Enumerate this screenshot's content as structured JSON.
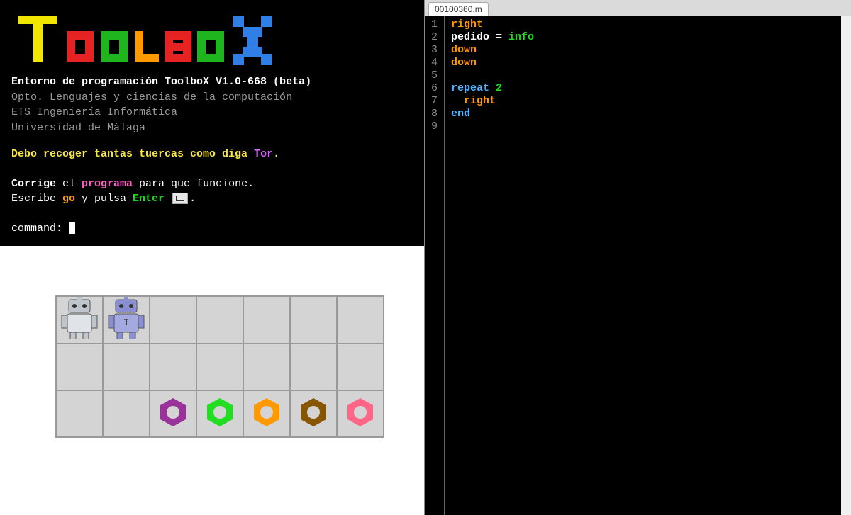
{
  "logo": {
    "letters": [
      "T",
      "O",
      "O",
      "L",
      "B",
      "O",
      "X"
    ]
  },
  "console": {
    "version": "Entorno de programación ToolboX V1.0-668 (beta)",
    "dept": "Opto. Lenguajes y ciencias de la computación",
    "school": "ETS Ingeniería Informática",
    "university": "Universidad de Málaga",
    "task_pre": "Debo recoger tantas tuercas como diga ",
    "task_name": "Tor",
    "task_post": ".",
    "inst_corrige": "Corrige",
    "inst_el": " el ",
    "inst_programa": "programa",
    "inst_rest": " para que funcione.",
    "inst2_pre": "Escribe ",
    "inst2_go": "go",
    "inst2_mid": " y pulsa ",
    "inst2_enter": "Enter",
    "inst2_post": ".",
    "command_label": "command: "
  },
  "grid": {
    "rows": 3,
    "cols": 7,
    "robots": [
      {
        "row": 0,
        "col": 0,
        "name": "robot-gray"
      },
      {
        "row": 0,
        "col": 1,
        "name": "robot-blue"
      }
    ],
    "nuts": [
      {
        "row": 2,
        "col": 2,
        "color": "#993399"
      },
      {
        "row": 2,
        "col": 3,
        "color": "#22dd22"
      },
      {
        "row": 2,
        "col": 4,
        "color": "#ff9900"
      },
      {
        "row": 2,
        "col": 5,
        "color": "#885500"
      },
      {
        "row": 2,
        "col": 6,
        "color": "#ff6688"
      }
    ]
  },
  "editor": {
    "tab": "00100360.m",
    "lines": [
      [
        {
          "t": "right",
          "c": "tok-cmd"
        }
      ],
      [
        {
          "t": "pedido ",
          "c": "tok-var"
        },
        {
          "t": "= ",
          "c": "tok-var"
        },
        {
          "t": "info",
          "c": "tok-func"
        }
      ],
      [
        {
          "t": "down",
          "c": "tok-cmd"
        }
      ],
      [
        {
          "t": "down",
          "c": "tok-cmd"
        }
      ],
      [],
      [
        {
          "t": "repeat ",
          "c": "tok-kw"
        },
        {
          "t": "2",
          "c": "tok-num"
        }
      ],
      [
        {
          "t": "  right",
          "c": "tok-cmd"
        }
      ],
      [
        {
          "t": "end",
          "c": "tok-kw"
        }
      ],
      []
    ]
  }
}
